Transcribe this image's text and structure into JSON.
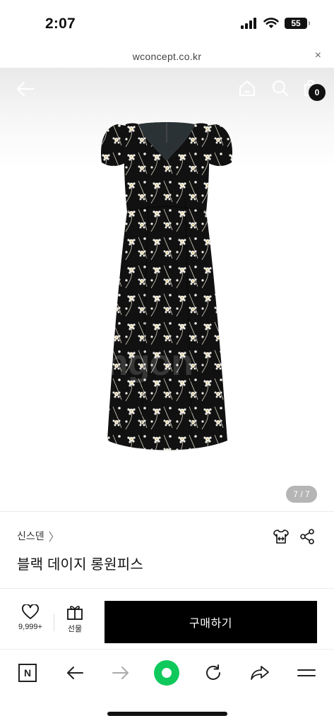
{
  "status": {
    "time": "2:07",
    "battery": "55"
  },
  "browser": {
    "url": "wconcept.co.kr",
    "close_icon": "×"
  },
  "header": {
    "cart_count": "0"
  },
  "gallery": {
    "watermark": "ngon",
    "page_indicator": "7 / 7"
  },
  "product": {
    "brand": "신스덴",
    "brand_chevron": "〉",
    "name": "블랙 데이지 롱원피스"
  },
  "actions": {
    "like_count": "9,999+",
    "gift_label": "선물",
    "buy_label": "구매하기"
  },
  "toolbar": {
    "naver_label": "N"
  },
  "colors": {
    "accent_green": "#10c95c",
    "buy_button": "#000000"
  },
  "icons": [
    "signal-icon",
    "wifi-icon",
    "battery-icon",
    "back-arrow-icon",
    "home-icon",
    "search-icon",
    "cart-icon",
    "hanger-icon",
    "share-icon",
    "heart-icon",
    "gift-icon",
    "naver-icon",
    "forward-arrow-icon",
    "reload-icon",
    "menu-icon"
  ]
}
